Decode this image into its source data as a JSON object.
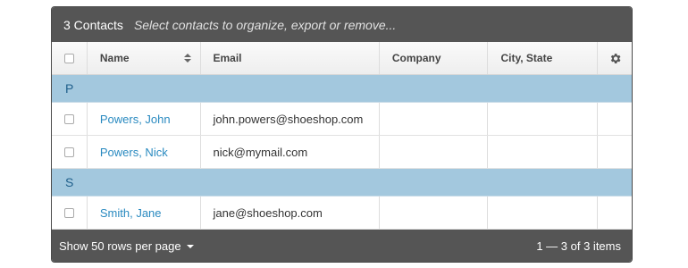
{
  "topbar": {
    "count_label": "3 Contacts",
    "hint": "Select contacts to organize, export or remove..."
  },
  "columns": {
    "name": "Name",
    "email": "Email",
    "company": "Company",
    "city_state": "City, State"
  },
  "groups": [
    {
      "letter": "P",
      "rows": [
        {
          "name": "Powers, John",
          "email": "john.powers@shoeshop.com",
          "company": "",
          "city_state": ""
        },
        {
          "name": "Powers, Nick",
          "email": "nick@mymail.com",
          "company": "",
          "city_state": ""
        }
      ]
    },
    {
      "letter": "S",
      "rows": [
        {
          "name": "Smith, Jane",
          "email": "jane@shoeshop.com",
          "company": "",
          "city_state": ""
        }
      ]
    }
  ],
  "footer": {
    "rows_per_page": "Show 50 rows per page",
    "pagination": "1 — 3 of 3 items"
  },
  "icons": {
    "gear": "gear-icon",
    "sort": "sort-icon",
    "dropdown": "chevron-down-icon"
  },
  "colors": {
    "bar": "#555555",
    "group_header": "#a3c8de",
    "link": "#2a8ac0"
  }
}
